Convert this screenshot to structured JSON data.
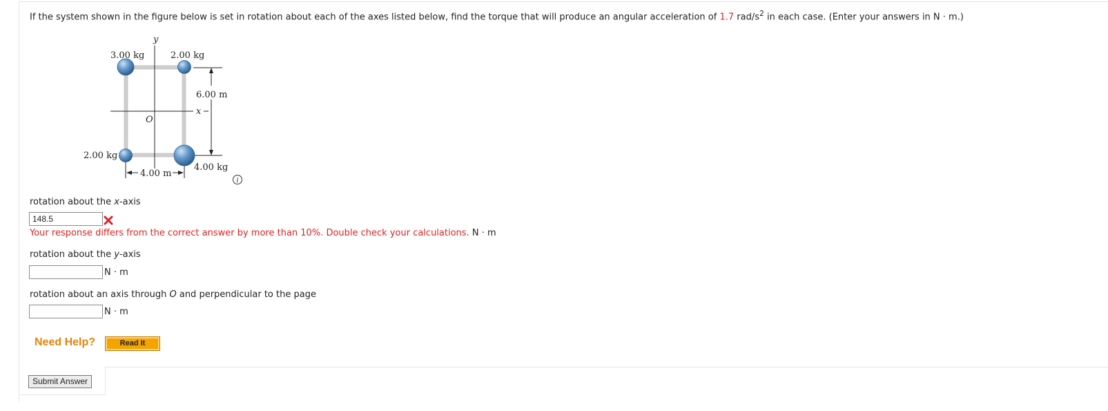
{
  "question": {
    "text_before": "If the system shown in the figure below is set in rotation about each of the axes listed below, find the torque that will produce an angular acceleration of ",
    "alpha_value": "1.7",
    "alpha_unit": " rad/s",
    "alpha_exp": "2",
    "text_after": " in each case. (Enter your answers in N · m.)"
  },
  "figure": {
    "mass_top_left": "3.00 kg",
    "mass_top_right": "2.00 kg",
    "mass_bottom_left": "2.00 kg",
    "mass_bottom_right": "4.00 kg",
    "width_label": "4.00 m",
    "height_label": "6.00 m",
    "y_axis": "y",
    "x_axis": "x",
    "origin": "O",
    "info_icon": "info-circle-icon"
  },
  "parts": [
    {
      "label_pre": "rotation about the ",
      "label_var": "x",
      "label_post": "-axis",
      "value": "148.5",
      "status": "incorrect",
      "feedback": "Your response differs from the correct answer by more than 10%. Double check your calculations.",
      "unit": "N · m"
    },
    {
      "label_pre": "rotation about the ",
      "label_var": "y",
      "label_post": "-axis",
      "value": "",
      "unit": "N · m"
    },
    {
      "label_pre": "rotation about an axis through ",
      "label_var": "O",
      "label_post": " and perpendicular to the page",
      "value": "",
      "unit": "N · m"
    }
  ],
  "help": {
    "label": "Need Help?",
    "read_it": "Read It"
  },
  "submit_label": "Submit Answer",
  "colors": {
    "accent_red": "#e02020",
    "help_orange": "#e8820c",
    "button_orange": "#f4a300",
    "ball_blue": "#4a86bf"
  }
}
